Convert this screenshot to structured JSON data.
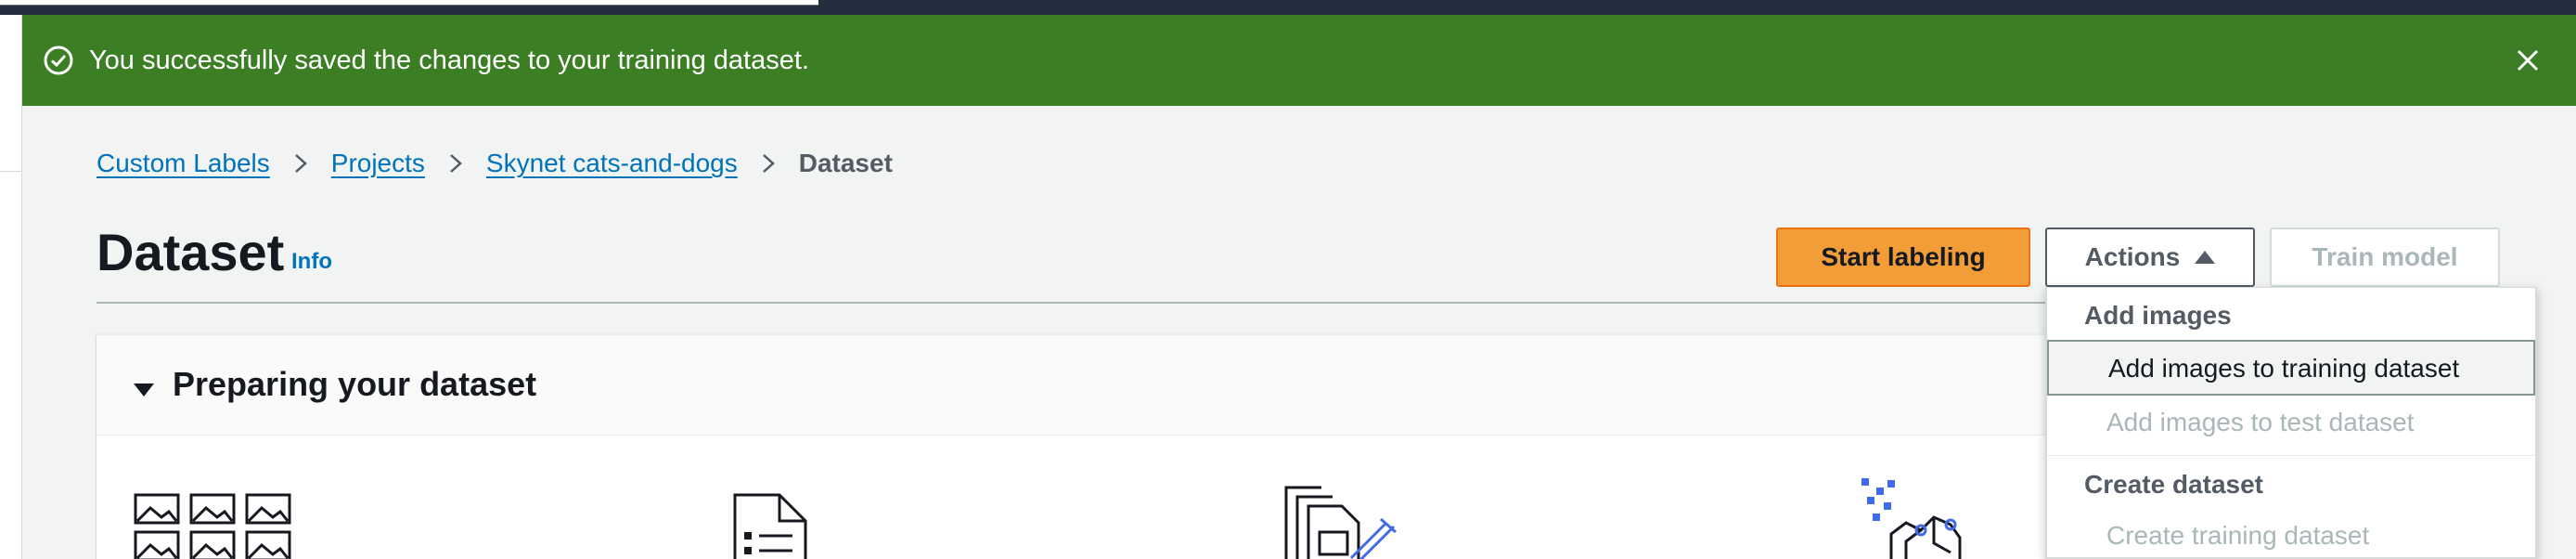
{
  "flash": {
    "message": "You successfully saved the changes to your training dataset.",
    "type": "success",
    "color": "#3b7e24"
  },
  "breadcrumb": {
    "items": [
      "Custom Labels",
      "Projects",
      "Skynet cats-and-dogs"
    ],
    "current": "Dataset"
  },
  "header": {
    "title": "Dataset",
    "info_label": "Info"
  },
  "buttons": {
    "start_labeling": "Start labeling",
    "actions": "Actions",
    "train_model": "Train model"
  },
  "actions_menu": {
    "groups": [
      {
        "label": "Add images",
        "items": [
          {
            "label": "Add images to training dataset",
            "state": "highlighted"
          },
          {
            "label": "Add images to test dataset",
            "state": "disabled"
          }
        ]
      },
      {
        "label": "Create dataset",
        "items": [
          {
            "label": "Create training dataset",
            "state": "disabled"
          }
        ]
      }
    ]
  },
  "panel": {
    "title": "Preparing your dataset",
    "expanded": true
  },
  "colors": {
    "link": "#0073bb",
    "primary_button": "#f29d38",
    "accent_blue": "#3f6ce6"
  }
}
